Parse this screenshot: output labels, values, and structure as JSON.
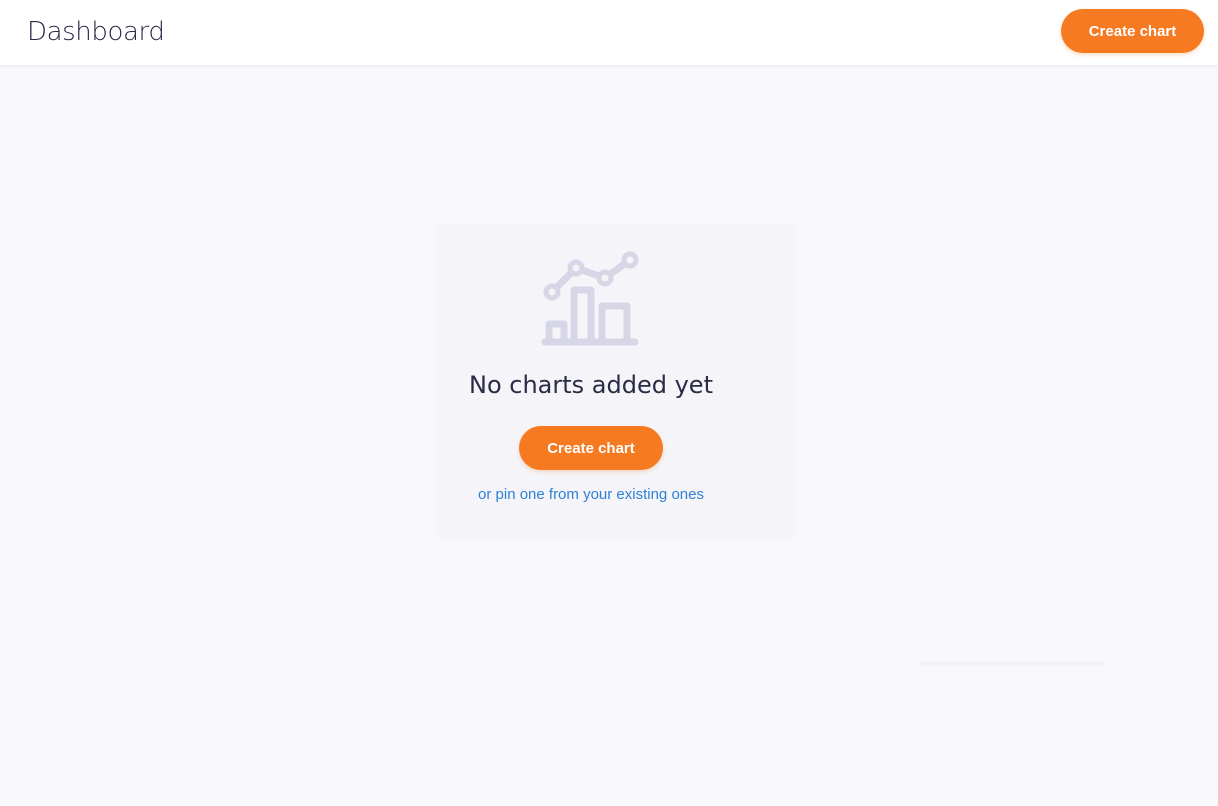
{
  "header": {
    "title": "Dashboard",
    "create_button_label": "Create chart"
  },
  "empty_state": {
    "icon": "chart-icon",
    "title": "No charts added yet",
    "create_button_label": "Create chart",
    "pin_link_text": "or pin one from your existing ones"
  },
  "colors": {
    "accent": "#f57a21",
    "link": "#2f80d4",
    "icon": "#d6d6e6",
    "background": "#f9f9fb"
  }
}
